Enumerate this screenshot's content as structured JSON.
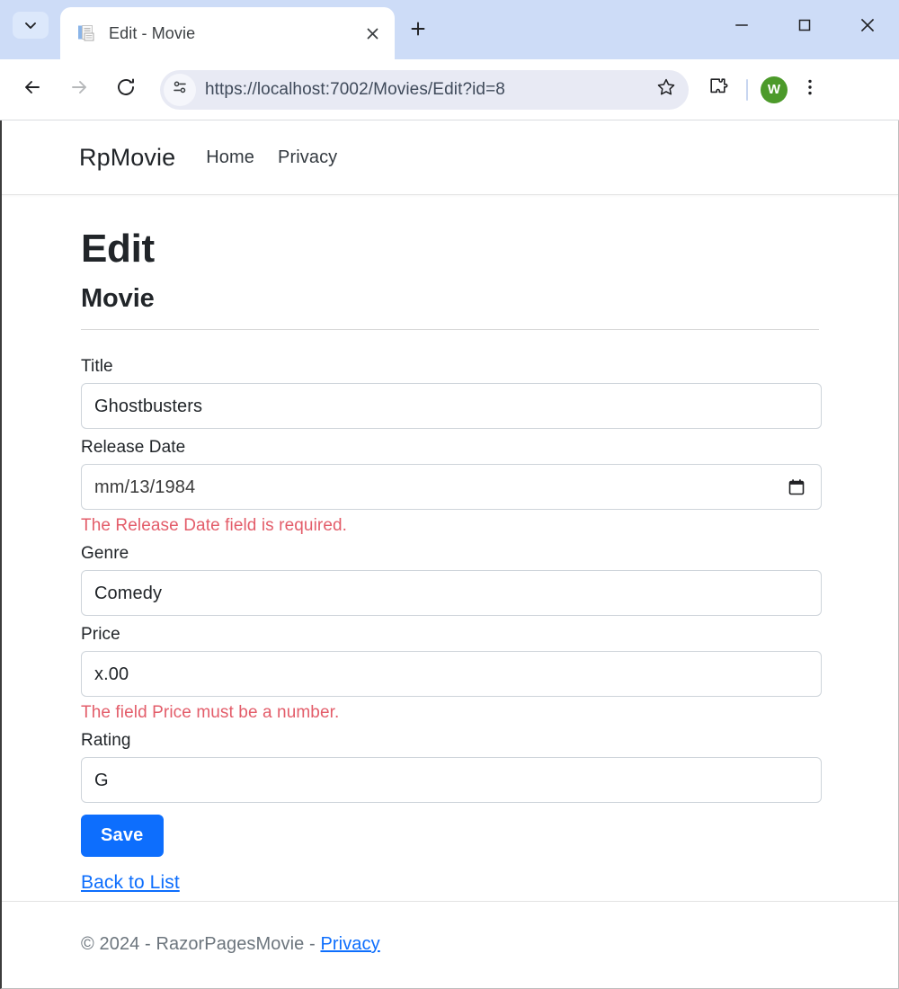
{
  "browser": {
    "tab": {
      "title": "Edit - Movie",
      "favicon_name": "document-favicon",
      "close_label": "×"
    },
    "new_tab_label": "+",
    "tab_search_name": "tab-search-icon",
    "window_controls": {
      "minimize": "—",
      "maximize": "□",
      "close": "✕"
    },
    "nav": {
      "back": "←",
      "forward": "→",
      "reload": "⟳"
    },
    "omnibox": {
      "url": "https://localhost:7002/Movies/Edit?id=8",
      "site_settings_icon": "tune-icon",
      "bookmark_icon": "star-icon"
    },
    "extensions_icon": "puzzle-piece-icon",
    "menu_icon": "three-dot-menu-icon",
    "profile": {
      "initial": "W",
      "color": "#4c9a2a"
    }
  },
  "site": {
    "brand": "RpMovie",
    "nav_links": [
      {
        "label": "Home"
      },
      {
        "label": "Privacy"
      }
    ],
    "page": {
      "title": "Edit",
      "subtitle": "Movie"
    },
    "form": {
      "fields": [
        {
          "label": "Title",
          "value": "Ghostbusters",
          "name": "title-input",
          "error": null,
          "picker": false
        },
        {
          "label": "Release Date",
          "value": "mm/13/1984",
          "name": "release-date-input",
          "error": "The Release Date field is required.",
          "picker": true
        },
        {
          "label": "Genre",
          "value": "Comedy",
          "name": "genre-input",
          "error": null,
          "picker": false
        },
        {
          "label": "Price",
          "value": "x.00",
          "name": "price-input",
          "error": "The field Price must be a number.",
          "picker": false
        },
        {
          "label": "Rating",
          "value": "G",
          "name": "rating-input",
          "error": null,
          "picker": false
        }
      ],
      "save_label": "Save",
      "back_link_label": "Back to List",
      "accent_color": "#0d6efd",
      "error_color": "#e35d6a"
    },
    "footer": {
      "copyright": "© 2024 - RazorPagesMovie -",
      "privacy_label": "Privacy"
    }
  }
}
